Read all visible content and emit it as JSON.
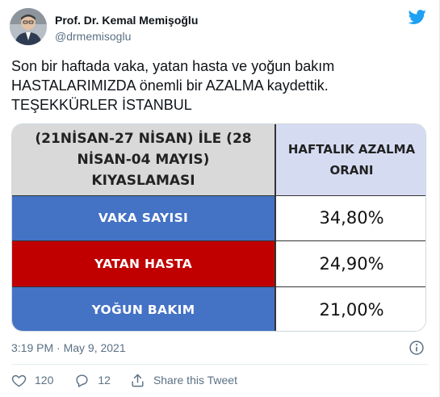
{
  "author": {
    "name": "Prof. Dr. Kemal Memişoğlu",
    "handle": "@drmemisoglu"
  },
  "tweet": {
    "lines": [
      "Son bir haftada vaka, yatan hasta ve yoğun bakım",
      "HASTALARIMIZDA önemli bir AZALMA kaydettik.",
      "TEŞEKKÜRLER İSTANBUL"
    ],
    "timestamp": "3:19 PM · May 9, 2021"
  },
  "table": {
    "header_left_line1": "(21NİSAN-27 NİSAN) İLE (28",
    "header_left_line2": "NİSAN-04 MAYIS) KIYASLAMASI",
    "header_right_line1": "HAFTALIK AZALMA",
    "header_right_line2": "ORANI",
    "rows": [
      {
        "label": "VAKA SAYISI",
        "value": "34,80%",
        "color": "#4472c4"
      },
      {
        "label": "YATAN HASTA",
        "value": "24,90%",
        "color": "#c00000"
      },
      {
        "label": "YOĞUN BAKIM",
        "value": "21,00%",
        "color": "#4472c4"
      }
    ]
  },
  "actions": {
    "like_count": "120",
    "reply_count": "12",
    "share_label": "Share this Tweet"
  },
  "icons": {
    "brand": "twitter-bird-icon",
    "info": "info-icon",
    "like": "heart-icon",
    "reply": "reply-bubble-icon",
    "share": "share-icon"
  },
  "colors": {
    "twitter_blue": "#1da1f2",
    "muted_text": "#5b7083",
    "row_blue": "#4472c4",
    "row_red": "#c00000",
    "header_gray": "#d9d9d9",
    "header_lavender": "#d5dcf2"
  }
}
